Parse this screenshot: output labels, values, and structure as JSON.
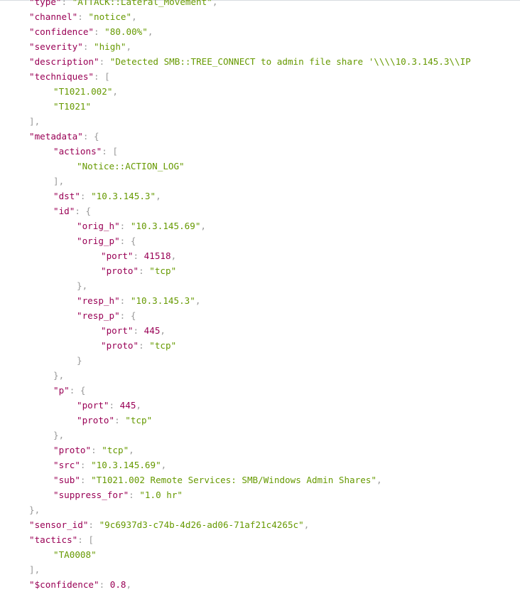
{
  "lines": [
    {
      "indent": 0,
      "key": "type",
      "value": "ATTACK::Lateral_Movement",
      "vtype": "string",
      "comma": true
    },
    {
      "indent": 0,
      "key": "channel",
      "value": "notice",
      "vtype": "string",
      "comma": true
    },
    {
      "indent": 0,
      "key": "confidence",
      "value": "80.00%",
      "vtype": "string",
      "comma": true
    },
    {
      "indent": 0,
      "key": "severity",
      "value": "high",
      "vtype": "string",
      "comma": true
    },
    {
      "indent": 0,
      "key": "description",
      "value": "Detected SMB::TREE_CONNECT to admin file share '\\\\\\\\10.3.145.3\\\\IP",
      "vtype": "string-truncated",
      "comma": false
    },
    {
      "indent": 0,
      "key": "techniques",
      "open": "["
    },
    {
      "indent": 1,
      "value": "T1021.002",
      "vtype": "string",
      "comma": true
    },
    {
      "indent": 1,
      "value": "T1021",
      "vtype": "string",
      "comma": false
    },
    {
      "indent": 0,
      "close": "]",
      "comma": true
    },
    {
      "indent": 0,
      "key": "metadata",
      "open": "{"
    },
    {
      "indent": 1,
      "key": "actions",
      "open": "["
    },
    {
      "indent": 2,
      "value": "Notice::ACTION_LOG",
      "vtype": "string",
      "comma": false
    },
    {
      "indent": 1,
      "close": "]",
      "comma": true
    },
    {
      "indent": 1,
      "key": "dst",
      "value": "10.3.145.3",
      "vtype": "string",
      "comma": true
    },
    {
      "indent": 1,
      "key": "id",
      "open": "{"
    },
    {
      "indent": 2,
      "key": "orig_h",
      "value": "10.3.145.69",
      "vtype": "string",
      "comma": true
    },
    {
      "indent": 2,
      "key": "orig_p",
      "open": "{"
    },
    {
      "indent": 3,
      "key": "port",
      "value": "41518",
      "vtype": "number",
      "comma": true
    },
    {
      "indent": 3,
      "key": "proto",
      "value": "tcp",
      "vtype": "string",
      "comma": false
    },
    {
      "indent": 2,
      "close": "}",
      "comma": true
    },
    {
      "indent": 2,
      "key": "resp_h",
      "value": "10.3.145.3",
      "vtype": "string",
      "comma": true
    },
    {
      "indent": 2,
      "key": "resp_p",
      "open": "{"
    },
    {
      "indent": 3,
      "key": "port",
      "value": "445",
      "vtype": "number",
      "comma": true
    },
    {
      "indent": 3,
      "key": "proto",
      "value": "tcp",
      "vtype": "string",
      "comma": false
    },
    {
      "indent": 2,
      "close": "}",
      "comma": false
    },
    {
      "indent": 1,
      "close": "}",
      "comma": true
    },
    {
      "indent": 1,
      "key": "p",
      "open": "{"
    },
    {
      "indent": 2,
      "key": "port",
      "value": "445",
      "vtype": "number",
      "comma": true
    },
    {
      "indent": 2,
      "key": "proto",
      "value": "tcp",
      "vtype": "string",
      "comma": false
    },
    {
      "indent": 1,
      "close": "}",
      "comma": true
    },
    {
      "indent": 1,
      "key": "proto",
      "value": "tcp",
      "vtype": "string",
      "comma": true
    },
    {
      "indent": 1,
      "key": "src",
      "value": "10.3.145.69",
      "vtype": "string",
      "comma": true
    },
    {
      "indent": 1,
      "key": "sub",
      "value": "T1021.002 Remote Services: SMB/Windows Admin Shares",
      "vtype": "string",
      "comma": true
    },
    {
      "indent": 1,
      "key": "suppress_for",
      "value": "1.0 hr",
      "vtype": "string",
      "comma": false
    },
    {
      "indent": 0,
      "close": "}",
      "comma": true
    },
    {
      "indent": 0,
      "key": "sensor_id",
      "value": "9c6937d3-c74b-4d26-ad06-71af21c4265c",
      "vtype": "string",
      "comma": true
    },
    {
      "indent": 0,
      "key": "tactics",
      "open": "["
    },
    {
      "indent": 1,
      "value": "TA0008",
      "vtype": "string",
      "comma": false
    },
    {
      "indent": 0,
      "close": "]",
      "comma": true
    },
    {
      "indent": 0,
      "key": "$confidence",
      "value": "0.8",
      "vtype": "number",
      "comma": true
    }
  ]
}
